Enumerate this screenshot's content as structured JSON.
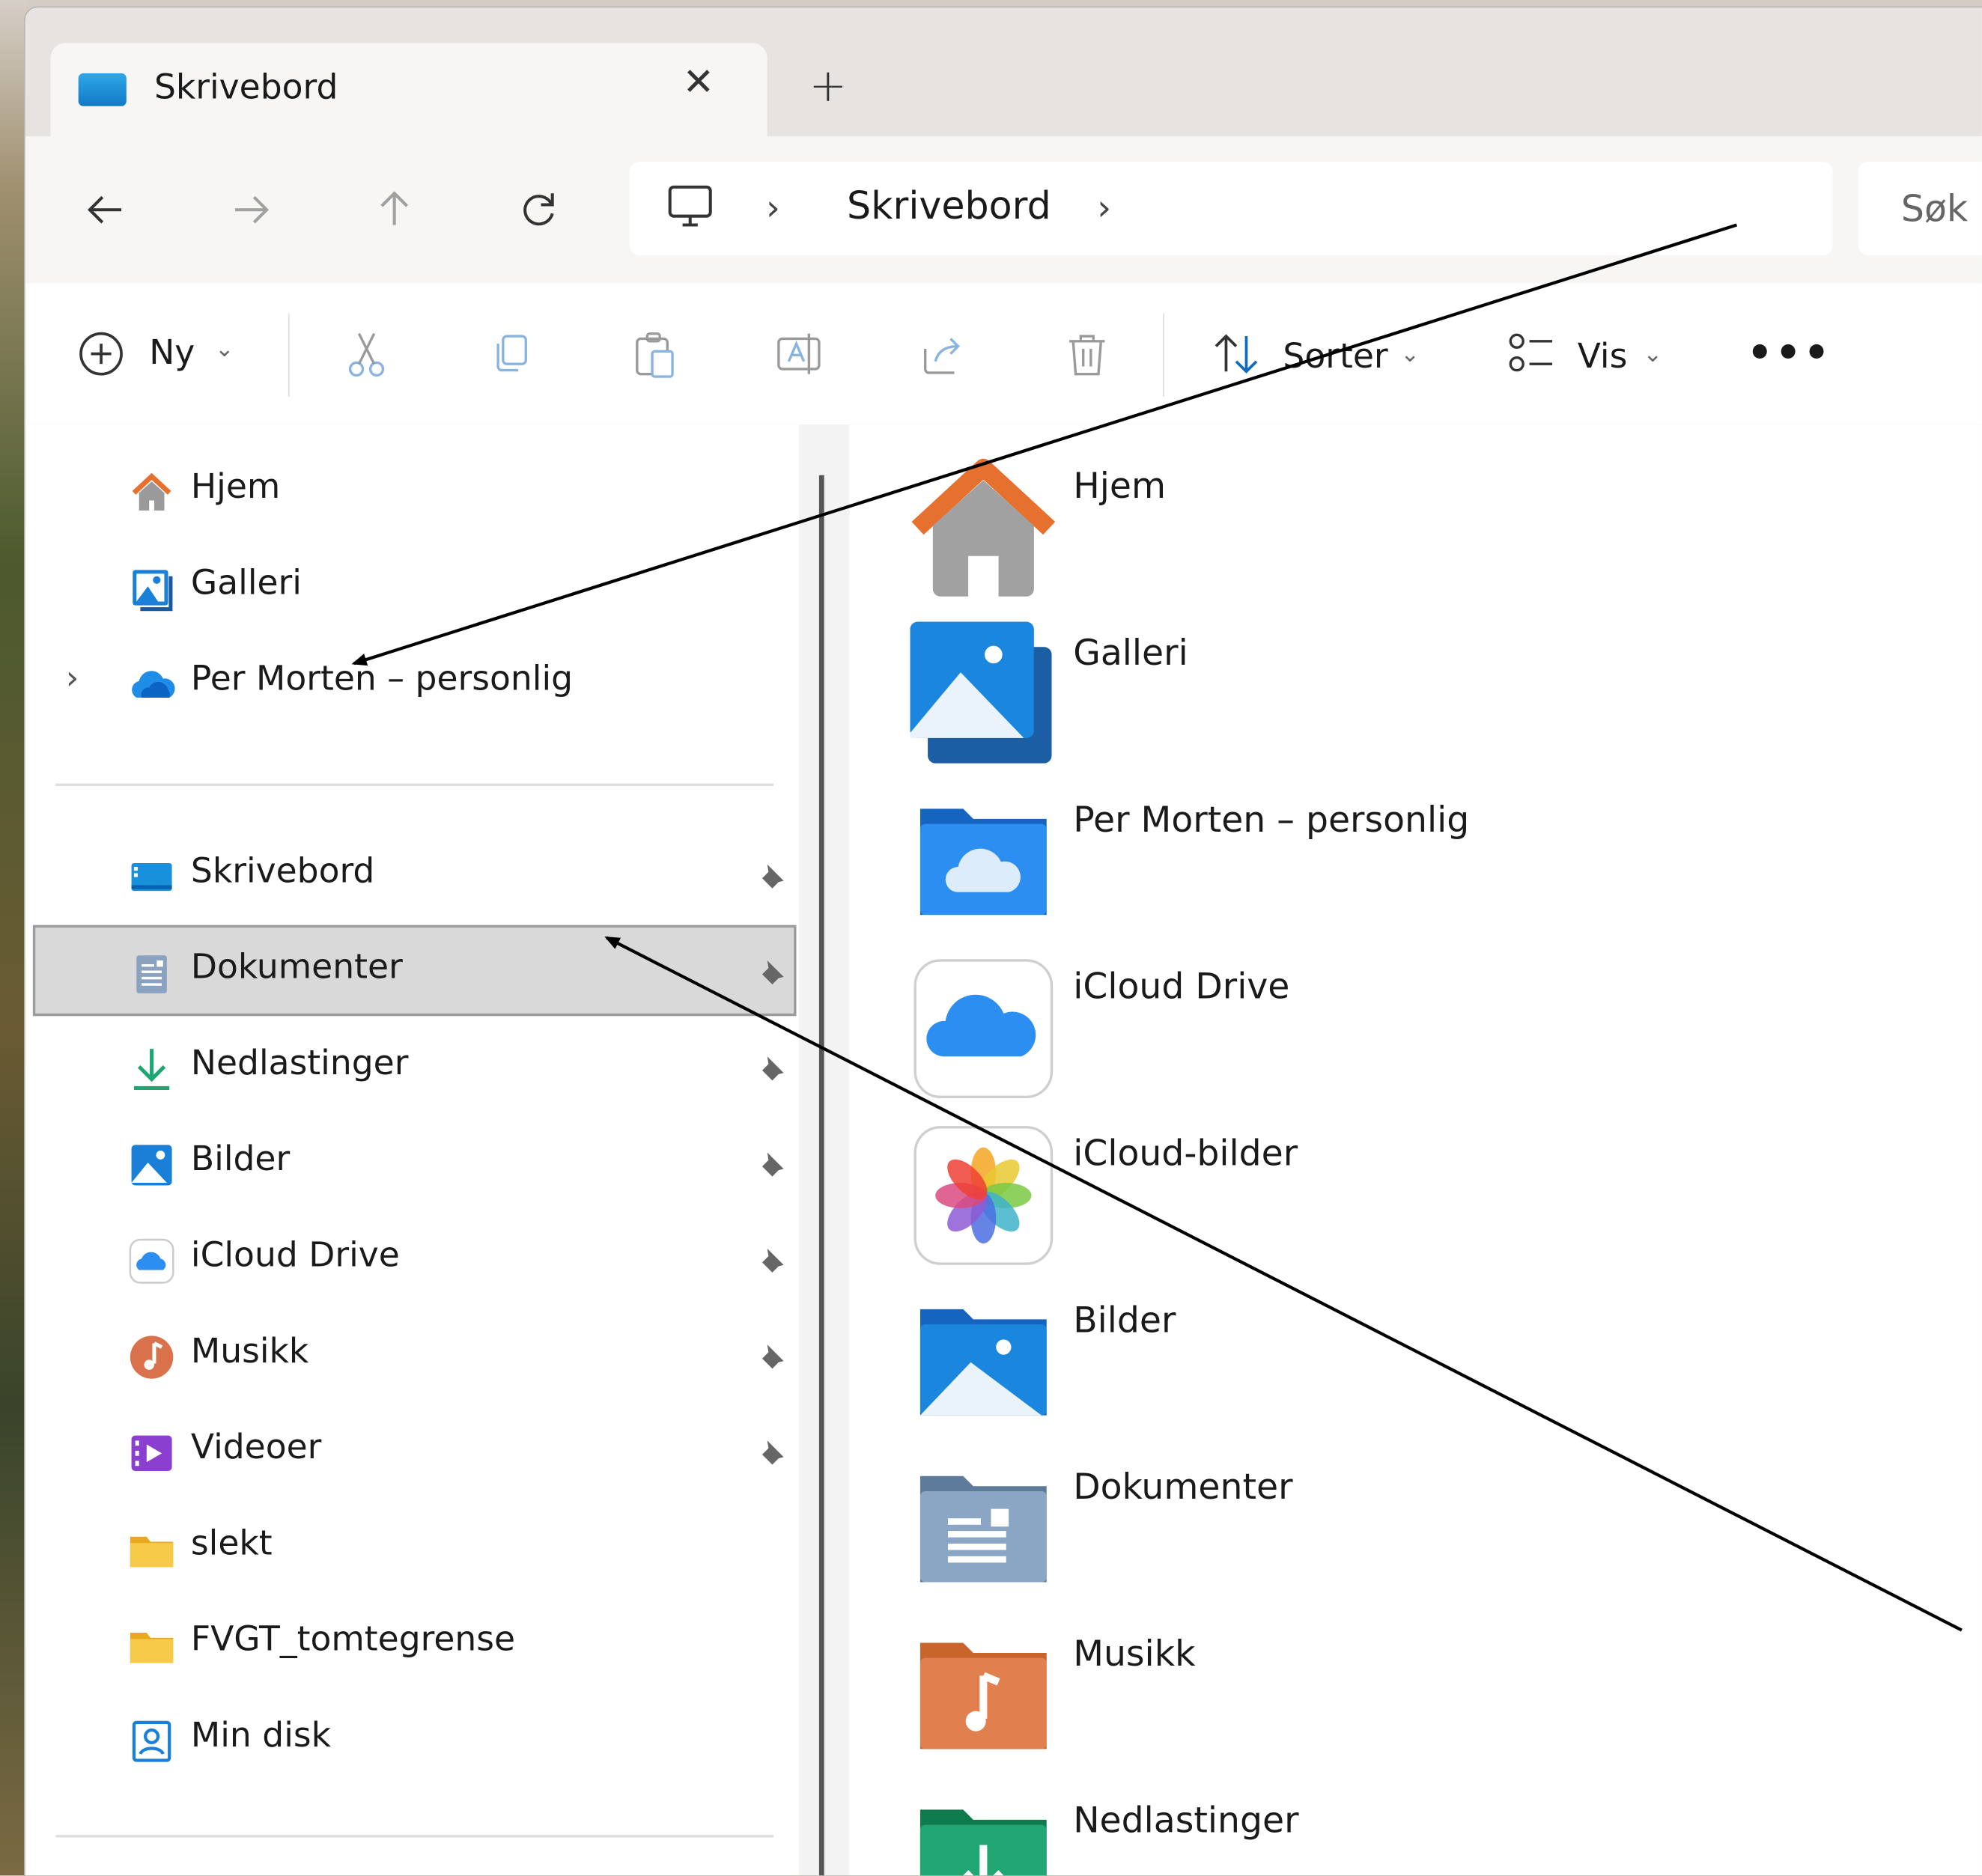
{
  "tab": {
    "title": "Skrivebord",
    "close_glyph": "✕",
    "new_glyph": "+"
  },
  "address": {
    "segment": "Skrivebord",
    "chevron": "›"
  },
  "search": {
    "placeholder": "Søk"
  },
  "toolbar": {
    "new_label": "Ny",
    "sort_label": "Sorter",
    "view_label": "Vis",
    "more_glyph": "•••",
    "dropdown_glyph": "⌄"
  },
  "sidebar": {
    "expand_glyph": "›",
    "items": [
      {
        "label": "Hjem",
        "icon": "home-icon"
      },
      {
        "label": "Galleri",
        "icon": "gallery-icon"
      },
      {
        "label": "Per Morten – personlig",
        "icon": "onedrive-icon"
      },
      {
        "label": "Skrivebord",
        "icon": "desktop-icon",
        "pinned": true
      },
      {
        "label": "Dokumenter",
        "icon": "documents-icon",
        "pinned": true,
        "selected": true
      },
      {
        "label": "Nedlastinger",
        "icon": "downloads-icon",
        "pinned": true
      },
      {
        "label": "Bilder",
        "icon": "pictures-icon",
        "pinned": true
      },
      {
        "label": "iCloud Drive",
        "icon": "icloud-icon",
        "pinned": true
      },
      {
        "label": "Musikk",
        "icon": "music-icon",
        "pinned": true
      },
      {
        "label": "Videoer",
        "icon": "videos-icon",
        "pinned": true
      },
      {
        "label": "slekt",
        "icon": "folder-icon"
      },
      {
        "label": "FVGT_tomtegrense",
        "icon": "folder-icon"
      },
      {
        "label": "Min disk",
        "icon": "user-folder-icon"
      }
    ]
  },
  "content": {
    "items": [
      {
        "label": "Hjem",
        "icon": "home-icon"
      },
      {
        "label": "Galleri",
        "icon": "gallery-icon"
      },
      {
        "label": "Per Morten – personlig",
        "icon": "onedrive-folder-icon"
      },
      {
        "label": "iCloud Drive",
        "icon": "icloud-drive-icon"
      },
      {
        "label": "iCloud-bilder",
        "icon": "icloud-photos-icon"
      },
      {
        "label": "Bilder",
        "icon": "pictures-folder-icon"
      },
      {
        "label": "Dokumenter",
        "icon": "documents-folder-icon"
      },
      {
        "label": "Musikk",
        "icon": "music-folder-icon"
      },
      {
        "label": "Nedlastinger",
        "icon": "downloads-folder-icon"
      }
    ]
  },
  "colors": {
    "accent": "#0f6cbd",
    "selection": "#d9d9d9",
    "folder_yellow": "#f7c948"
  }
}
